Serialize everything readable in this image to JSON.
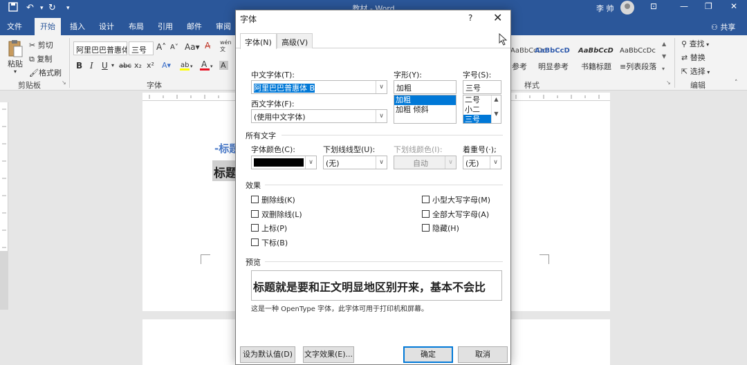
{
  "titlebar": {
    "title": "教材 - Word",
    "user": "李 帅",
    "qa_save_icon": "save-icon",
    "qa_undo_icon": "undo-icon",
    "qa_redo_icon": "redo-icon",
    "qa_more": "▾"
  },
  "tabs": [
    {
      "label": "文件"
    },
    {
      "label": "开始"
    },
    {
      "label": "插入"
    },
    {
      "label": "设计"
    },
    {
      "label": "布局"
    },
    {
      "label": "引用"
    },
    {
      "label": "邮件"
    },
    {
      "label": "审阅"
    }
  ],
  "share_label": "共享",
  "ribbon": {
    "clipboard": {
      "paste": "粘贴",
      "cut": "剪切",
      "copy": "复制",
      "format_painter": "格式刷",
      "group": "剪贴板"
    },
    "font": {
      "name": "阿里巴巴普惠体",
      "size": "三号",
      "group": "字体",
      "bold": "B",
      "italic": "I",
      "underline": "U",
      "strike": "abc",
      "sub": "x₂",
      "sup": "x²"
    },
    "styles": {
      "group": "样式",
      "previews": [
        "AaBbCcDc",
        "AaBbCcD",
        "AaBbCcD",
        "AaBbCcDc"
      ],
      "names": [
        "参考",
        "明显参考",
        "书籍标题",
        "列表段落"
      ]
    },
    "editing": {
      "find": "查找",
      "replace": "替换",
      "select": "选择",
      "group": "编辑"
    }
  },
  "document": {
    "heading2": "-标题",
    "heading1": "标题"
  },
  "dialog": {
    "title": "字体",
    "help": "?",
    "tabs": [
      {
        "label": "字体(N)"
      },
      {
        "label": "高级(V)"
      }
    ],
    "cn_font_label": "中文字体(T):",
    "cn_font_value": "阿里巴巴普惠体 B",
    "west_font_label": "西文字体(F):",
    "west_font_value": "(使用中文字体)",
    "style_label": "字形(Y):",
    "style_value": "加粗",
    "style_list": [
      "加粗",
      "加粗 倾斜"
    ],
    "size_label": "字号(S):",
    "size_value": "三号",
    "size_list": [
      "二号",
      "小二",
      "三号"
    ],
    "all_text_section": "所有文字",
    "font_color_label": "字体颜色(C):",
    "font_color": "#000000",
    "underline_type_label": "下划线线型(U):",
    "underline_type_value": "(无)",
    "underline_color_label": "下划线颜色(I):",
    "underline_color_value": "自动",
    "emphasis_label": "着重号(·);",
    "emphasis_value": "(无)",
    "effects_section": "效果",
    "effects_left": [
      "删除线(K)",
      "双删除线(L)",
      "上标(P)",
      "下标(B)"
    ],
    "effects_right": [
      "小型大写字母(M)",
      "全部大写字母(A)",
      "隐藏(H)"
    ],
    "preview_section": "预览",
    "preview_text": "标题就是要和正文明显地区别开来，基本不会比",
    "note": "这是一种 OpenType 字体，此字体可用于打印机和屏幕。",
    "btn_default": "设为默认值(D)",
    "btn_effects": "文字效果(E)...",
    "btn_ok": "确定",
    "btn_cancel": "取消"
  }
}
